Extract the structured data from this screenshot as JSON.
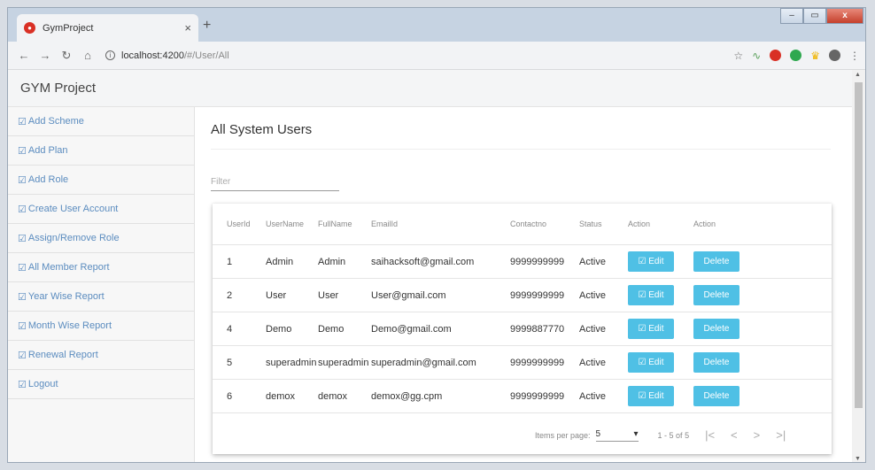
{
  "browser": {
    "tab_title": "GymProject",
    "tab_close": "×",
    "new_tab": "+",
    "url_host": "localhost:4200",
    "url_path": "/#/User/All",
    "win_min": "–",
    "win_max": "▭",
    "win_close": "x"
  },
  "app": {
    "brand": "GYM Project"
  },
  "sidebar": {
    "items": [
      {
        "label": "Add Scheme"
      },
      {
        "label": "Add Plan"
      },
      {
        "label": "Add Role"
      },
      {
        "label": "Create User Account"
      },
      {
        "label": "Assign/Remove Role"
      },
      {
        "label": "All Member Report"
      },
      {
        "label": "Year Wise Report"
      },
      {
        "label": "Month Wise Report"
      },
      {
        "label": "Renewal Report"
      },
      {
        "label": "Logout"
      }
    ]
  },
  "main": {
    "title": "All System Users",
    "filter_placeholder": "Filter",
    "columns": [
      "UserId",
      "UserName",
      "FullName",
      "EmailId",
      "Contactno",
      "Status",
      "Action",
      "Action"
    ],
    "rows": [
      {
        "id": "1",
        "username": "Admin",
        "fullname": "Admin",
        "email": "saihacksoft@gmail.com",
        "contact": "9999999999",
        "status": "Active"
      },
      {
        "id": "2",
        "username": "User",
        "fullname": "User",
        "email": "User@gmail.com",
        "contact": "9999999999",
        "status": "Active"
      },
      {
        "id": "4",
        "username": "Demo",
        "fullname": "Demo",
        "email": "Demo@gmail.com",
        "contact": "9999887770",
        "status": "Active"
      },
      {
        "id": "5",
        "username": "superadmin",
        "fullname": "superadmin",
        "email": "superadmin@gmail.com",
        "contact": "9999999999",
        "status": "Active"
      },
      {
        "id": "6",
        "username": "demox",
        "fullname": "demox",
        "email": "demox@gg.cpm",
        "contact": "9999999999",
        "status": "Active"
      }
    ],
    "edit_label": "Edit",
    "delete_label": "Delete",
    "paginator": {
      "items_per_page_label": "Items per page:",
      "items_per_page_value": "5",
      "range": "1 - 5 of 5"
    }
  },
  "icons": {
    "edit_glyph": "☑",
    "first_page": "|<",
    "prev_page": "<",
    "next_page": ">",
    "last_page": ">|"
  }
}
